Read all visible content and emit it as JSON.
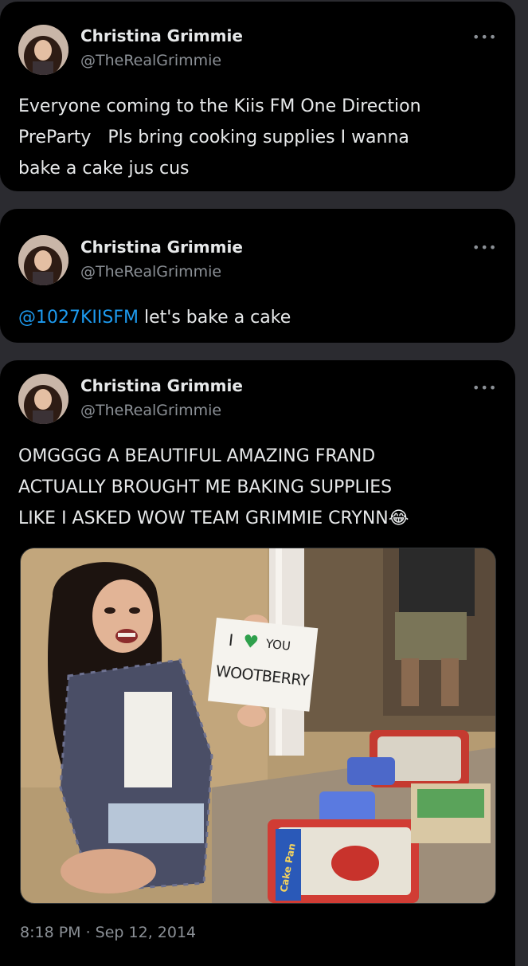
{
  "tweets": [
    {
      "author_name": "Christina Grimmie",
      "author_handle": "@TheRealGrimmie",
      "more_label": "•••",
      "text_lines": [
        "Everyone coming to the Kiis FM One Direction",
        "PreParty   Pls bring cooking supplies I wanna",
        "bake a cake jus cus"
      ]
    },
    {
      "author_name": "Christina Grimmie",
      "author_handle": "@TheRealGrimmie",
      "more_label": "•••",
      "mention": "@1027KIISFM",
      "text_after_mention": " let's bake a cake"
    },
    {
      "author_name": "Christina Grimmie",
      "author_handle": "@TheRealGrimmie",
      "more_label": "•••",
      "text_lines": [
        "OMGGGG A BEAUTIFUL AMAZING FRAND",
        "ACTUALLY BROUGHT ME BAKING SUPPLIES",
        "LIKE I ASKED WOW TEAM GRIMMIE CRYNN😂"
      ],
      "photo": {
        "sign_line1": "I",
        "sign_heart": "♥",
        "sign_line1b": "YOU",
        "sign_line2": "WOOTBERRY",
        "box_label": "Cake Pan"
      },
      "timestamp": "8:18 PM · Sep 12, 2014"
    }
  ],
  "colors": {
    "background": "#2b2b30",
    "card": "#000000",
    "text": "#e7e9ea",
    "secondary": "#8b9096",
    "link": "#1d9bf0"
  },
  "icons": {
    "more": "more-horizontal-icon",
    "emoji": "face-with-tears-of-joy"
  }
}
